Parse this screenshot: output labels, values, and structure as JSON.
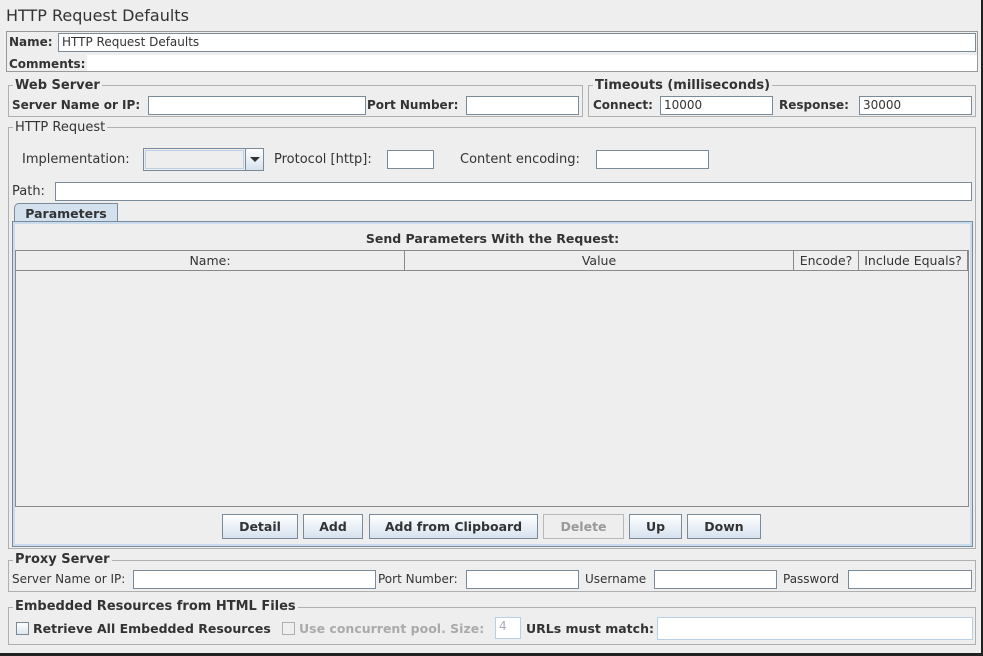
{
  "title": "HTTP Request Defaults",
  "name_label": "Name:",
  "name_value": "HTTP Request Defaults",
  "comments_label": "Comments:",
  "comments_value": "",
  "web_server": {
    "legend": "Web Server",
    "server_label": "Server Name or IP:",
    "server_value": "",
    "port_label": "Port Number:",
    "port_value": ""
  },
  "timeouts": {
    "legend": "Timeouts (milliseconds)",
    "connect_label": "Connect:",
    "connect_value": "10000",
    "response_label": "Response:",
    "response_value": "30000"
  },
  "http_request": {
    "legend": "HTTP Request",
    "implementation_label": "Implementation:",
    "implementation_value": "",
    "protocol_label": "Protocol [http]:",
    "protocol_value": "",
    "encoding_label": "Content encoding:",
    "encoding_value": "",
    "path_label": "Path:",
    "path_value": ""
  },
  "tabs": [
    {
      "label": "Parameters",
      "active": true
    }
  ],
  "parameters": {
    "heading": "Send Parameters With the Request:",
    "columns": [
      "Name:",
      "Value",
      "Encode?",
      "Include Equals?"
    ],
    "rows": []
  },
  "buttons": {
    "detail": "Detail",
    "add": "Add",
    "add_clipboard": "Add from Clipboard",
    "delete": "Delete",
    "up": "Up",
    "down": "Down"
  },
  "proxy": {
    "legend": "Proxy Server",
    "server_label": "Server Name or IP:",
    "server_value": "",
    "port_label": "Port Number:",
    "port_value": "",
    "username_label": "Username",
    "username_value": "",
    "password_label": "Password",
    "password_value": ""
  },
  "embedded": {
    "legend": "Embedded Resources from HTML Files",
    "retrieve_label": "Retrieve All Embedded Resources",
    "retrieve_checked": false,
    "pool_label": "Use concurrent pool. Size:",
    "pool_checked": false,
    "pool_size": "4",
    "urls_label": "URLs must match:",
    "urls_value": ""
  }
}
